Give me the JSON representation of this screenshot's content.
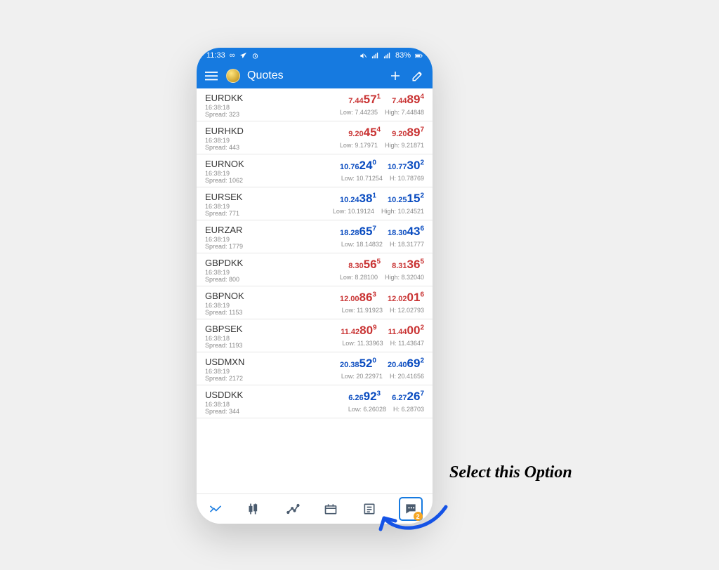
{
  "status": {
    "time": "11:33",
    "battery": "83%"
  },
  "header": {
    "title": "Quotes"
  },
  "spread_prefix": "Spread: ",
  "quotes": [
    {
      "symbol": "EURDKK",
      "time": "16:38:18",
      "spread": "323",
      "bid_pre": "7.44",
      "bid_big": "57",
      "bid_sup": "1",
      "ask_pre": "7.44",
      "ask_big": "89",
      "ask_sup": "4",
      "color": "red",
      "low": "Low: 7.44235",
      "high": "High: 7.44848"
    },
    {
      "symbol": "EURHKD",
      "time": "16:38:19",
      "spread": "443",
      "bid_pre": "9.20",
      "bid_big": "45",
      "bid_sup": "4",
      "ask_pre": "9.20",
      "ask_big": "89",
      "ask_sup": "7",
      "color": "red",
      "low": "Low: 9.17971",
      "high": "High: 9.21871"
    },
    {
      "symbol": "EURNOK",
      "time": "16:38:19",
      "spread": "1062",
      "bid_pre": "10.76",
      "bid_big": "24",
      "bid_sup": "0",
      "ask_pre": "10.77",
      "ask_big": "30",
      "ask_sup": "2",
      "color": "blue",
      "low": "Low: 10.71254",
      "high": "H: 10.78769"
    },
    {
      "symbol": "EURSEK",
      "time": "16:38:19",
      "spread": "771",
      "bid_pre": "10.24",
      "bid_big": "38",
      "bid_sup": "1",
      "ask_pre": "10.25",
      "ask_big": "15",
      "ask_sup": "2",
      "color": "blue",
      "low": "Low: 10.19124",
      "high": "High: 10.24521"
    },
    {
      "symbol": "EURZAR",
      "time": "16:38:19",
      "spread": "1779",
      "bid_pre": "18.28",
      "bid_big": "65",
      "bid_sup": "7",
      "ask_pre": "18.30",
      "ask_big": "43",
      "ask_sup": "6",
      "color": "blue",
      "low": "Low: 18.14832",
      "high": "H: 18.31777"
    },
    {
      "symbol": "GBPDKK",
      "time": "16:38:19",
      "spread": "800",
      "bid_pre": "8.30",
      "bid_big": "56",
      "bid_sup": "5",
      "ask_pre": "8.31",
      "ask_big": "36",
      "ask_sup": "5",
      "color": "red",
      "low": "Low: 8.28100",
      "high": "High: 8.32040"
    },
    {
      "symbol": "GBPNOK",
      "time": "16:38:19",
      "spread": "1153",
      "bid_pre": "12.00",
      "bid_big": "86",
      "bid_sup": "3",
      "ask_pre": "12.02",
      "ask_big": "01",
      "ask_sup": "6",
      "color": "red",
      "low": "Low: 11.91923",
      "high": "H: 12.02793"
    },
    {
      "symbol": "GBPSEK",
      "time": "16:38:18",
      "spread": "1193",
      "bid_pre": "11.42",
      "bid_big": "80",
      "bid_sup": "9",
      "ask_pre": "11.44",
      "ask_big": "00",
      "ask_sup": "2",
      "color": "red",
      "low": "Low: 11.33963",
      "high": "H: 11.43647"
    },
    {
      "symbol": "USDMXN",
      "time": "16:38:19",
      "spread": "2172",
      "bid_pre": "20.38",
      "bid_big": "52",
      "bid_sup": "0",
      "ask_pre": "20.40",
      "ask_big": "69",
      "ask_sup": "2",
      "color": "blue",
      "low": "Low: 20.22971",
      "high": "H: 20.41656"
    },
    {
      "symbol": "USDDKK",
      "time": "16:38:18",
      "spread": "344",
      "bid_pre": "6.26",
      "bid_big": "92",
      "bid_sup": "3",
      "ask_pre": "6.27",
      "ask_big": "26",
      "ask_sup": "7",
      "color": "blue",
      "low": "Low: 6.26028",
      "high": "H: 6.28703"
    }
  ],
  "footer": {
    "badge": "2"
  },
  "annotation": {
    "text": "Select this Option"
  }
}
